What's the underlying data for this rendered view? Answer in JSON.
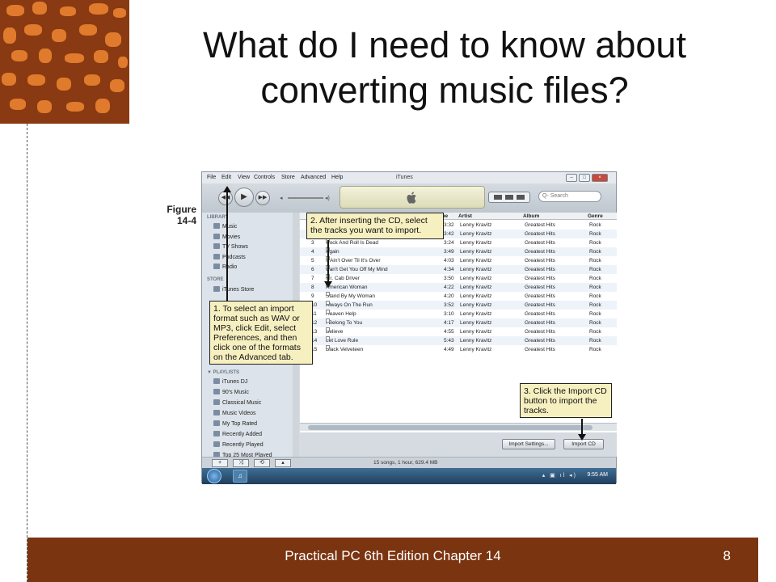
{
  "slide": {
    "title_line1": "What do I need to know about",
    "title_line2": "converting music files?",
    "footer": "Practical PC 6th Edition Chapter 14",
    "page_number": "8"
  },
  "figure": {
    "label_line1": "Figure",
    "label_line2": "14-4"
  },
  "itunes": {
    "menu": [
      "File",
      "Edit",
      "View",
      "Controls",
      "Store",
      "Advanced",
      "Help"
    ],
    "window_title": "iTunes",
    "search_placeholder": "Q- Search",
    "sidebar": {
      "library_head": "LIBRARY",
      "library": [
        "Music",
        "Movies",
        "TV Shows",
        "Podcasts",
        "Radio"
      ],
      "store_head": "STORE",
      "store": [
        "iTunes Store"
      ],
      "playlists_head": "▼ PLAYLISTS",
      "playlists": [
        "iTunes DJ",
        "90's Music",
        "Classical Music",
        "Music Videos",
        "My Top Rated",
        "Recently Added",
        "Recently Played",
        "Top 25 Most Played"
      ]
    },
    "columns": [
      "Time",
      "Artist",
      "Album",
      "Genre"
    ],
    "tracks": [
      {
        "num": "1",
        "name": "",
        "time": "3:32",
        "artist": "Lenny Kravitz",
        "album": "Greatest Hits",
        "genre": "Rock",
        "checked": false
      },
      {
        "num": "2",
        "name": "",
        "time": "3:42",
        "artist": "Lenny Kravitz",
        "album": "Greatest Hits",
        "genre": "Rock",
        "checked": false
      },
      {
        "num": "3",
        "name": "Rock And Roll Is Dead",
        "time": "3:24",
        "artist": "Lenny Kravitz",
        "album": "Greatest Hits",
        "genre": "Rock",
        "checked": false
      },
      {
        "num": "4",
        "name": "Again",
        "time": "3:49",
        "artist": "Lenny Kravitz",
        "album": "Greatest Hits",
        "genre": "Rock",
        "checked": false
      },
      {
        "num": "5",
        "name": "It Ain't Over Til It's Over",
        "time": "4:03",
        "artist": "Lenny Kravitz",
        "album": "Greatest Hits",
        "genre": "Rock",
        "checked": false
      },
      {
        "num": "6",
        "name": "Can't Get You Off My Mind",
        "time": "4:34",
        "artist": "Lenny Kravitz",
        "album": "Greatest Hits",
        "genre": "Rock",
        "checked": false
      },
      {
        "num": "7",
        "name": "Mr. Cab Driver",
        "time": "3:50",
        "artist": "Lenny Kravitz",
        "album": "Greatest Hits",
        "genre": "Rock",
        "checked": false
      },
      {
        "num": "8",
        "name": "American Woman",
        "time": "4:22",
        "artist": "Lenny Kravitz",
        "album": "Greatest Hits",
        "genre": "Rock",
        "checked": true
      },
      {
        "num": "9",
        "name": "Stand By My Woman",
        "time": "4:20",
        "artist": "Lenny Kravitz",
        "album": "Greatest Hits",
        "genre": "Rock",
        "checked": false
      },
      {
        "num": "10",
        "name": "Always On The Run",
        "time": "3:52",
        "artist": "Lenny Kravitz",
        "album": "Greatest Hits",
        "genre": "Rock",
        "checked": false
      },
      {
        "num": "11",
        "name": "Heaven Help",
        "time": "3:10",
        "artist": "Lenny Kravitz",
        "album": "Greatest Hits",
        "genre": "Rock",
        "checked": false
      },
      {
        "num": "12",
        "name": "I Belong To You",
        "time": "4:17",
        "artist": "Lenny Kravitz",
        "album": "Greatest Hits",
        "genre": "Rock",
        "checked": false
      },
      {
        "num": "13",
        "name": "Believe",
        "time": "4:55",
        "artist": "Lenny Kravitz",
        "album": "Greatest Hits",
        "genre": "Rock",
        "checked": false
      },
      {
        "num": "14",
        "name": "Let Love Rule",
        "time": "5:43",
        "artist": "Lenny Kravitz",
        "album": "Greatest Hits",
        "genre": "Rock",
        "checked": false
      },
      {
        "num": "15",
        "name": "Black Velveteen",
        "time": "4:49",
        "artist": "Lenny Kravitz",
        "album": "Greatest Hits",
        "genre": "Rock",
        "checked": false
      }
    ],
    "import_settings_label": "Import Settings...",
    "import_cd_label": "Import CD",
    "status_text": "15 songs, 1 hour, 629.4 MB",
    "clock": "9:55 AM"
  },
  "callouts": {
    "c1": "1. To select an import format such as WAV or MP3, click Edit, select Preferences, and then click one of the formats on the Advanced tab.",
    "c2": "2. After inserting the CD, select the tracks you want to import.",
    "c3": "3. Click the Import CD button to import the tracks."
  },
  "colors": {
    "footer_bg": "#7b3410",
    "callout_bg": "#f6efc0",
    "accent_art": "#8a3a12"
  }
}
